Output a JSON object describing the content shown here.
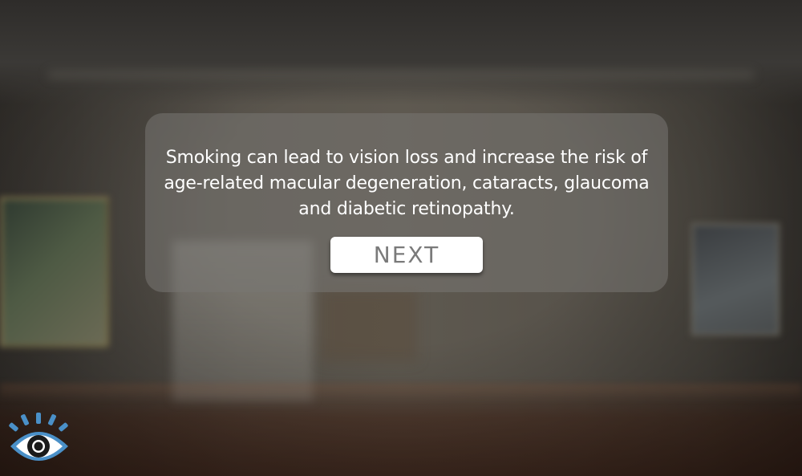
{
  "dialog": {
    "message": "Smoking can lead to vision loss and increase the risk of age-related macular degeneration, cataracts, glaucoma and diabetic retinopathy.",
    "next_label": "NEXT"
  },
  "icons": {
    "eye": "eye-icon"
  },
  "colors": {
    "eye_accent": "#4a90c8",
    "dialog_text": "#ffffff",
    "button_text": "#7a7a7a"
  }
}
